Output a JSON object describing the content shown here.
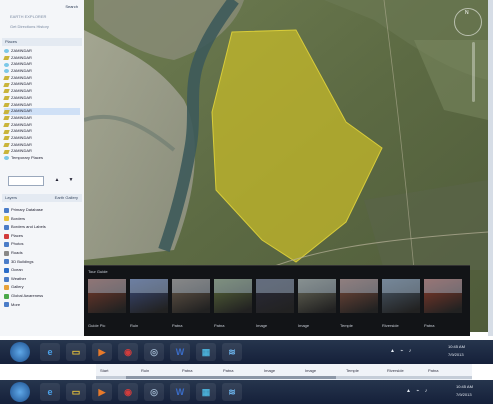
{
  "sidebar": {
    "search_title": "Search",
    "search_hint": "EARTH EXPLORER",
    "search_hint2": "Get Directions  History",
    "places_header": "Places",
    "places": [
      {
        "label": "ZAMINDAR",
        "icon": "placemark"
      },
      {
        "label": "ZAMINDAR",
        "icon": "polygon"
      },
      {
        "label": "ZAMINDAR",
        "icon": "placemark"
      },
      {
        "label": "ZAMINDAR",
        "icon": "placemark"
      },
      {
        "label": "ZAMINDAR",
        "icon": "polygon"
      },
      {
        "label": "ZAMINDAR",
        "icon": "polygon"
      },
      {
        "label": "ZAMINDAR",
        "icon": "polygon"
      },
      {
        "label": "ZAMINDAR",
        "icon": "polygon"
      },
      {
        "label": "ZAMINDAR",
        "icon": "polygon"
      },
      {
        "label": "ZAMINDAR",
        "icon": "polygon"
      },
      {
        "label": "ZAMINDAR",
        "icon": "polygon"
      },
      {
        "label": "ZAMINDAR",
        "icon": "polygon"
      },
      {
        "label": "ZAMINDAR",
        "icon": "polygon"
      },
      {
        "label": "ZAMINDAR",
        "icon": "polygon"
      },
      {
        "label": "ZAMINDAR",
        "icon": "polygon"
      },
      {
        "label": "ZAMINDAR",
        "icon": "polygon"
      },
      {
        "label": "Temporary Places",
        "icon": "folder"
      }
    ],
    "layers_header": "Layers",
    "layers_right": "Earth Gallery",
    "layers": [
      {
        "label": "Primary Database",
        "color": "#4a7cc8"
      },
      {
        "label": "Borders",
        "color": "#e8c23a"
      },
      {
        "label": "Borders and Labels",
        "color": "#4a7cc8"
      },
      {
        "label": "Places",
        "color": "#d23c3c"
      },
      {
        "label": "Photos",
        "color": "#4a7cc8"
      },
      {
        "label": "Roads",
        "color": "#888888"
      },
      {
        "label": "3D Buildings",
        "color": "#4a7cc8"
      },
      {
        "label": "Ocean",
        "color": "#2a6cc8"
      },
      {
        "label": "Weather",
        "color": "#4a7cc8"
      },
      {
        "label": "Gallery",
        "color": "#e8a23a"
      },
      {
        "label": "Global Awareness",
        "color": "#4aa84a"
      },
      {
        "label": "More",
        "color": "#4a7cc8"
      }
    ]
  },
  "tour": {
    "title": "Tour Guide",
    "items": [
      {
        "caption": "Guide Pic",
        "color": "#7a3a2a"
      },
      {
        "caption": "Ruin",
        "color": "#3a4a7a"
      },
      {
        "caption": "Patna",
        "color": "#6a5a4a"
      },
      {
        "caption": "Patna",
        "color": "#5a6a3a"
      },
      {
        "caption": "Image",
        "color": "#2a2a3a"
      },
      {
        "caption": "Image",
        "color": "#6a6a5a"
      },
      {
        "caption": "Temple",
        "color": "#7a4a3a"
      },
      {
        "caption": "Riverside",
        "color": "#4a5a6a"
      },
      {
        "caption": "Patna",
        "color": "#8a3a2a"
      }
    ]
  },
  "taskbar_top": {
    "time": "10:45 AM",
    "date": "7/9/2013",
    "apps": [
      "ie",
      "explorer",
      "media",
      "chrome",
      "app",
      "word",
      "paint",
      "app2"
    ]
  },
  "taskbar_bottom": {
    "time": "10:45 AM",
    "date": "7/9/2013",
    "apps": [
      "ie",
      "explorer",
      "media",
      "chrome",
      "app",
      "word",
      "paint",
      "app2"
    ]
  },
  "midstrip": {
    "labels": [
      "Start",
      "Ruin",
      "Patna",
      "Patna",
      "Image",
      "Image",
      "Temple",
      "Riverside",
      "Patna"
    ]
  }
}
